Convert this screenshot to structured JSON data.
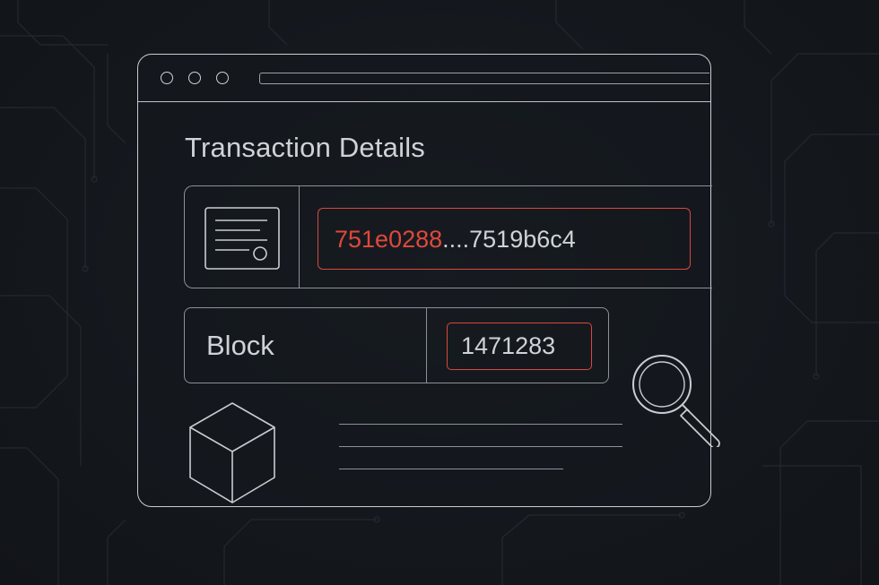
{
  "window": {
    "controls": [
      "close-dot",
      "minimize-dot",
      "maximize-dot"
    ]
  },
  "details": {
    "title": "Transaction Details",
    "hash_prefix": "751e0288",
    "hash_rest": "....7519b6c4",
    "block_label": "Block",
    "block_value": "1471283"
  },
  "icons": {
    "document": "document-icon",
    "cube": "cube-icon",
    "search": "magnifier-icon"
  },
  "colors": {
    "background": "#14181d",
    "outline": "#c9ccd0",
    "text": "#cfd2d6",
    "accent": "#e0483a"
  }
}
